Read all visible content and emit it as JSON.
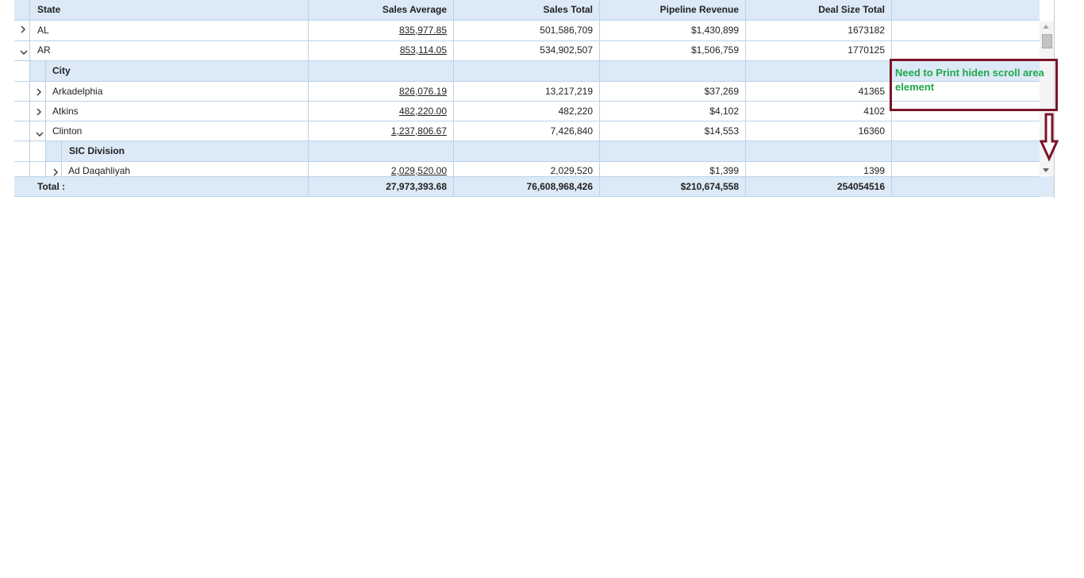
{
  "columns": [
    "State",
    "Sales Average",
    "Sales Total",
    "Pipeline Revenue",
    "Deal Size Total"
  ],
  "rows": [
    {
      "state": "AL",
      "sales_avg": "835,977.85",
      "sales_total": "501,586,709",
      "pipeline": "$1,430,899",
      "deal": "1673182"
    },
    {
      "state": "AR",
      "sales_avg": "853,114.05",
      "sales_total": "534,902,507",
      "pipeline": "$1,506,759",
      "deal": "1770125"
    }
  ],
  "city_header": "City",
  "cities": [
    {
      "name": "Arkadelphia",
      "sales_avg": "826,076.19",
      "sales_total": "13,217,219",
      "pipeline": "$37,269",
      "deal": "41365"
    },
    {
      "name": "Atkins",
      "sales_avg": "482,220.00",
      "sales_total": "482,220",
      "pipeline": "$4,102",
      "deal": "4102"
    },
    {
      "name": "Clinton",
      "sales_avg": "1,237,806.67",
      "sales_total": "7,426,840",
      "pipeline": "$14,553",
      "deal": "16360"
    }
  ],
  "sic_header": "SIC Division",
  "sic_rows": [
    {
      "name": "Ad Daqahliyah",
      "sales_avg": "2,029,520.00",
      "sales_total": "2,029,520",
      "pipeline": "$1,399",
      "deal": "1399"
    }
  ],
  "total": {
    "label": "Total :",
    "sales_avg": "27,973,393.68",
    "sales_total": "76,608,968,426",
    "pipeline": "$210,674,558",
    "deal": "254054516"
  },
  "annotation": "Need to Print hiden scroll area element",
  "colors": {
    "header_bg": "#dce9f6",
    "grid_line": "#b9d3ea",
    "annotation_border": "#7b1427",
    "annotation_text": "#1fa84a"
  },
  "icons": {
    "expand": "chevron-right-icon",
    "collapse": "chevron-down-icon",
    "annotation_arrow": "down-arrow-icon"
  }
}
